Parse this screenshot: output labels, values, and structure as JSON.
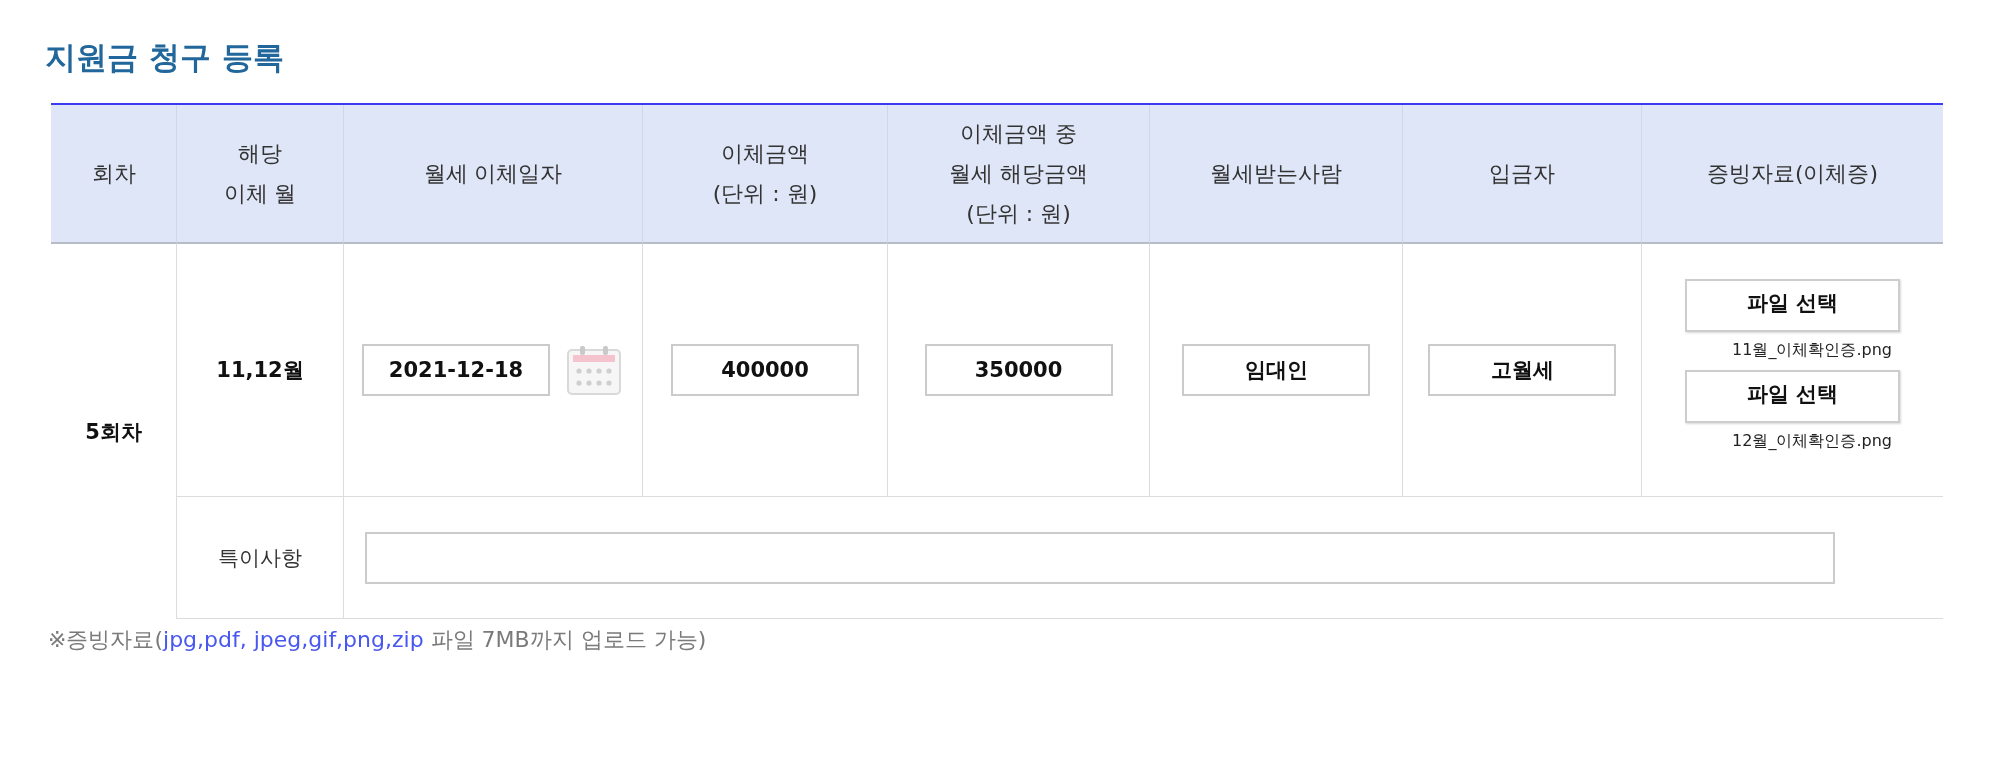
{
  "title": "지원금 청구 등록",
  "table": {
    "columns": [
      {
        "label": "회차"
      },
      {
        "label": "해당\n이체 월"
      },
      {
        "label": "월세 이체일자"
      },
      {
        "label": "이체금액\n(단위 : 원)"
      },
      {
        "label": "이체금액 중\n월세 해당금액\n(단위 : 원)"
      },
      {
        "label": "월세받는사람"
      },
      {
        "label": "입금자"
      },
      {
        "label": "증빙자료(이체증)"
      }
    ],
    "rows": [
      {
        "round": "5회차",
        "month": "11,12월",
        "transfer_date": "2021-12-18",
        "amount": "400000",
        "rent_amount": "350000",
        "recipient": "임대인",
        "depositor": "고월세",
        "evidence": [
          {
            "button": "파일 선택",
            "file_name": "11월_이체확인증.png"
          },
          {
            "button": "파일 선택",
            "file_name": "12월_이체확인증.png"
          }
        ],
        "remarks": {
          "label": "특이사항"
        }
      }
    ]
  },
  "footnote": {
    "prefix": "※증빙자료(",
    "highlight": "jpg,pdf, jpeg,gif,png,zip",
    "suffix": " 파일 7MB까지 업로드 가능)"
  }
}
